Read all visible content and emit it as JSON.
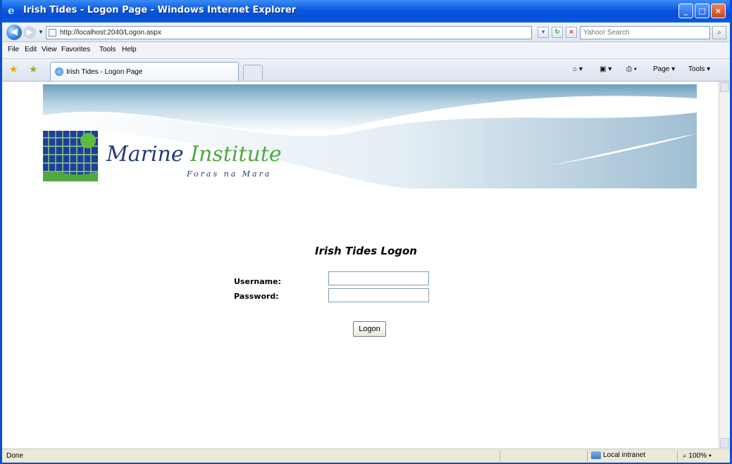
{
  "window": {
    "title": "Irish Tides - Logon Page - Windows Internet Explorer",
    "controls": {
      "minimize": "_",
      "maximize": "□",
      "close": "×"
    }
  },
  "address_bar": {
    "url": "http://localhost:2040/Logon.aspx",
    "search_placeholder": "Yahoo! Search"
  },
  "menu": [
    "File",
    "Edit",
    "View",
    "Favorites",
    "Tools",
    "Help"
  ],
  "tab": {
    "label": "Irish Tides - Logon Page"
  },
  "toolbar": {
    "page_label": "Page ▾",
    "tools_label": "Tools ▾"
  },
  "banner": {
    "brand_primary": "Marine",
    "brand_secondary": "Institute",
    "tagline": "Foras na Mara",
    "colors": {
      "brand_blue": "#23397a",
      "brand_green": "#4fa840",
      "wave": "#b9d3e3"
    }
  },
  "login": {
    "title": "Irish Tides Logon",
    "username_label": "Username:",
    "password_label": "Password:",
    "username_value": "",
    "password_value": "",
    "submit_label": "Logon"
  },
  "status_bar": {
    "text": "Done",
    "zone": "Local intranet",
    "zoom": "100%"
  },
  "icons": {
    "back": "back-arrow-icon",
    "forward": "forward-arrow-icon",
    "favorites": "favorites-star-icon",
    "add_favorites": "add-favorites-icon",
    "home": "home-icon",
    "feeds": "feeds-icon",
    "print": "print-icon",
    "zone": "local-intranet-icon"
  }
}
